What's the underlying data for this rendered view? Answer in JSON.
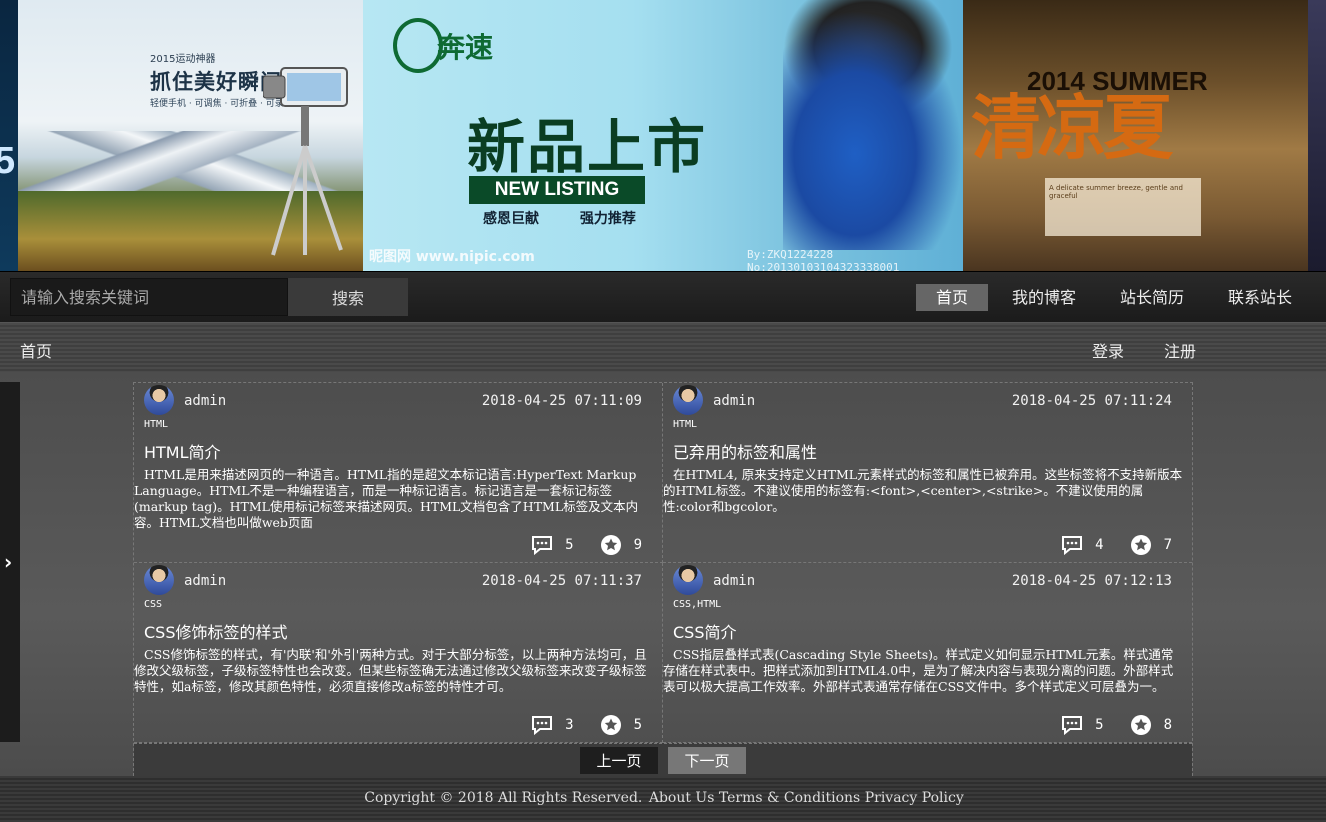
{
  "banner": {
    "edge_left_text": "5",
    "camera_slide": {
      "subtitle": "2015运动神器",
      "title": "抓住美好瞬间",
      "line": "轻便手机 · 可调焦 · 可折叠 · 可录像"
    },
    "shoe_slide": {
      "brand": "奔速",
      "title": "新品上市",
      "listing": "NEW LISTING",
      "tagline_left": "感恩巨献",
      "tagline_right": "强力推荐",
      "watermark": "昵图网 www.nipic.com",
      "image_id": "By:ZKQ1224228 No:20130103104323338001"
    },
    "summer_slide": {
      "heading": "2014 SUMMER",
      "title": "清凉夏",
      "box_text": "A delicate summer breeze, gentle and graceful"
    }
  },
  "topnav": {
    "search_placeholder": "请输入搜索关键词",
    "search_button": "搜索",
    "links": [
      "首页",
      "我的博客",
      "站长简历",
      "联系站长"
    ],
    "active_index": 0
  },
  "subbar": {
    "home": "首页",
    "login": "登录",
    "register": "注册"
  },
  "posts": [
    {
      "author": "admin",
      "date": "2018-04-25 07:11:09",
      "tag": "HTML",
      "title": "HTML简介",
      "excerpt": "HTML是用来描述网页的一种语言。HTML指的是超文本标记语言:HyperText Markup Language。HTML不是一种编程语言，而是一种标记语言。标记语言是一套标记标签(markup tag)。HTML使用标记标签来描述网页。HTML文档包含了HTML标签及文本内容。HTML文档也叫做web页面",
      "comments": "5",
      "favorites": "9"
    },
    {
      "author": "admin",
      "date": "2018-04-25 07:11:24",
      "tag": "HTML",
      "title": "已弃用的标签和属性",
      "excerpt": "在HTML4, 原来支持定义HTML元素样式的标签和属性已被弃用。这些标签将不支持新版本的HTML标签。不建议使用的标签有:<font>,<center>,<strike>。不建议使用的属性:color和bgcolor。",
      "comments": "4",
      "favorites": "7"
    },
    {
      "author": "admin",
      "date": "2018-04-25 07:11:37",
      "tag": "CSS",
      "title": "CSS修饰标签的样式",
      "excerpt": "CSS修饰标签的样式，有'内联'和'外引'两种方式。对于大部分标签，以上两种方法均可，且修改父级标签，子级标签特性也会改变。但某些标签确无法通过修改父级标签来改变子级标签特性，如a标签，修改其颜色特性，必须直接修改a标签的特性才可。",
      "comments": "3",
      "favorites": "5"
    },
    {
      "author": "admin",
      "date": "2018-04-25 07:12:13",
      "tag": "CSS,HTML",
      "title": "CSS简介",
      "excerpt": "CSS指层叠样式表(Cascading Style Sheets)。样式定义如何显示HTML元素。样式通常存储在样式表中。把样式添加到HTML4.0中，是为了解决内容与表现分离的问题。外部样式表可以极大提高工作效率。外部样式表通常存储在CSS文件中。多个样式定义可层叠为一。",
      "comments": "5",
      "favorites": "8"
    }
  ],
  "pager": {
    "prev": "上一页",
    "next": "下一页"
  },
  "footer": {
    "copyright": "Copyright © 2018 All Rights Reserved.",
    "about": "About Us",
    "terms": "Terms & Conditions",
    "privacy": "Privacy Policy"
  },
  "icons": {
    "comment": "comment-icon",
    "favorite": "star-icon",
    "side_arrow": "chevron-right-icon"
  }
}
